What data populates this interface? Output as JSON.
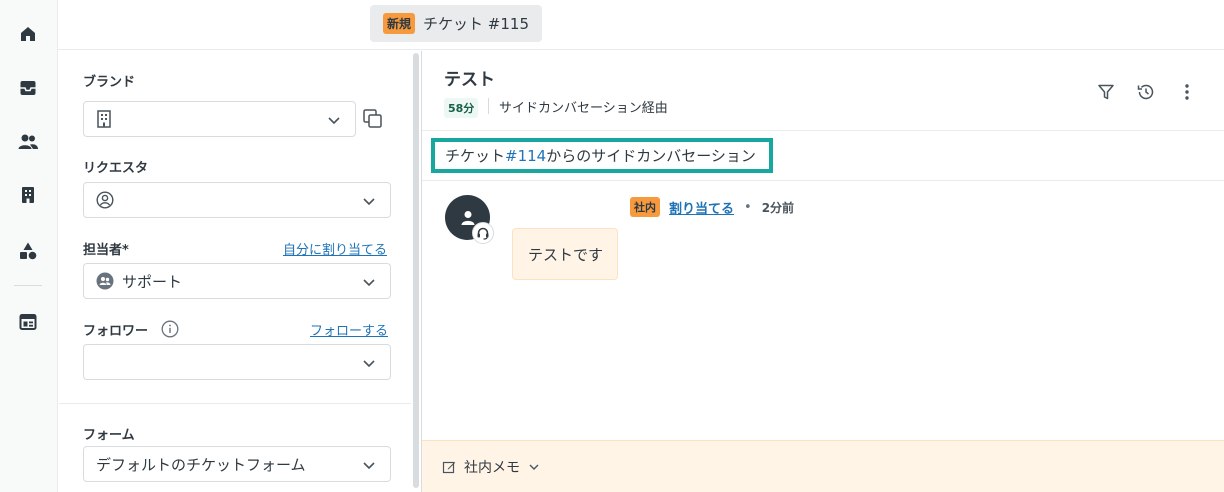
{
  "nav": {
    "items": [
      {
        "icon": "home-icon"
      },
      {
        "icon": "inbox-icon"
      },
      {
        "icon": "users-icon"
      },
      {
        "icon": "building-icon"
      },
      {
        "icon": "shapes-icon"
      },
      {
        "icon": "reporting-icon"
      }
    ]
  },
  "tab": {
    "badge": "新規",
    "title": "チケット #115"
  },
  "properties": {
    "brand": {
      "label": "ブランド",
      "value": ""
    },
    "requester": {
      "label": "リクエスタ",
      "value": ""
    },
    "assignee": {
      "label": "担当者*",
      "link": "自分に割り当てる",
      "value": "サポート"
    },
    "followers": {
      "label": "フォロワー",
      "link": "フォローする",
      "value": ""
    },
    "form": {
      "label": "フォーム",
      "value": "デフォルトのチケットフォーム"
    }
  },
  "conversation": {
    "title": "テスト",
    "time_badge": "58分",
    "via": "サイドカンバセーション経由",
    "notice": {
      "prefix": "チケット",
      "ticket": "#114",
      "suffix": "からのサイドカンバセーション"
    },
    "message": {
      "badge": "社内",
      "assign_link": "割り当てる",
      "dot": "•",
      "ago": "2分前",
      "body": "テストです"
    },
    "composer": {
      "label": "社内メモ"
    }
  },
  "colors": {
    "accent": "#1f73b7",
    "highlight": "#17a79f",
    "badge_orange": "#f79a3e",
    "internal_bg": "#fff4e6"
  }
}
